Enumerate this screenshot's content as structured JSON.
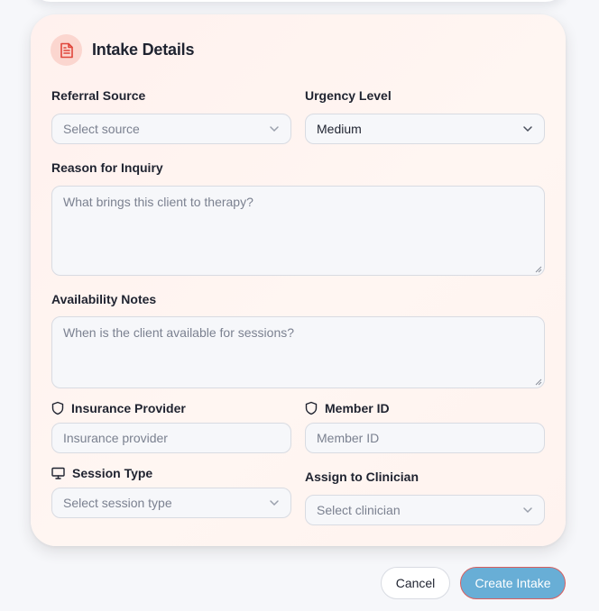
{
  "card": {
    "title": "Intake Details",
    "icon": "document-icon"
  },
  "fields": {
    "referral_source": {
      "label": "Referral Source",
      "placeholder": "Select source"
    },
    "urgency_level": {
      "label": "Urgency Level",
      "value": "Medium"
    },
    "reason": {
      "label": "Reason for Inquiry",
      "placeholder": "What brings this client to therapy?"
    },
    "availability": {
      "label": "Availability Notes",
      "placeholder": "When is the client available for sessions?"
    },
    "insurance_provider": {
      "label": "Insurance Provider",
      "placeholder": "Insurance provider",
      "icon": "shield-icon"
    },
    "member_id": {
      "label": "Member ID",
      "placeholder": "Member ID",
      "icon": "shield-icon"
    },
    "session_type": {
      "label": "Session Type",
      "placeholder": "Select session type",
      "icon": "monitor-icon"
    },
    "clinician": {
      "label": "Assign to Clinician",
      "placeholder": "Select clinician"
    }
  },
  "actions": {
    "cancel_label": "Cancel",
    "create_label": "Create Intake"
  },
  "colors": {
    "accent_red": "#e0453a",
    "primary_button": "#68aed6",
    "primary_border": "#d95f5f"
  }
}
